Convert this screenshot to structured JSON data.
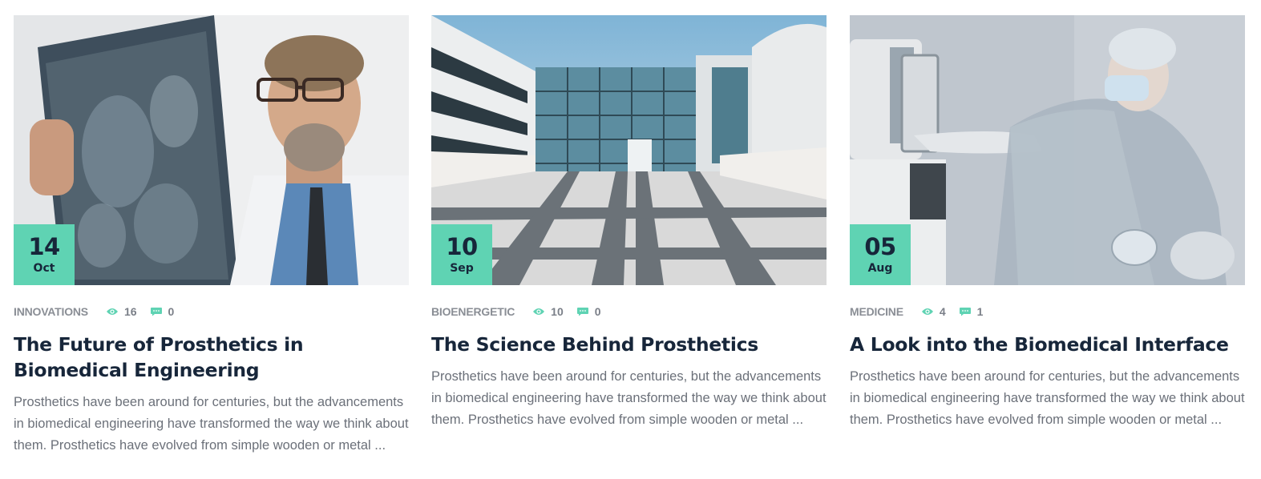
{
  "posts": [
    {
      "day": "14",
      "month": "Oct",
      "category": "INNOVATIONS",
      "views": "16",
      "comments": "0",
      "title": "The Future of Prosthetics in Biomedical Engineering",
      "excerpt": "Prosthetics have been around for centuries, but the advancements in biomedical engineering have transformed the way we think about them. Prosthetics have evolved from simple wooden or metal ..."
    },
    {
      "day": "10",
      "month": "Sep",
      "category": "BIOENERGETIC",
      "views": "10",
      "comments": "0",
      "title": "The Science Behind Prosthetics",
      "excerpt": "Prosthetics have been around for centuries, but the advancements in biomedical engineering have transformed the way we think about them. Prosthetics have evolved from simple wooden or metal ..."
    },
    {
      "day": "05",
      "month": "Aug",
      "category": "MEDICINE",
      "views": "4",
      "comments": "1",
      "title": "A Look into the Biomedical Interface",
      "excerpt": "Prosthetics have been around for centuries, but the advancements in biomedical engineering have transformed the way we think about them. Prosthetics have evolved from simple wooden or metal ..."
    }
  ],
  "colors": {
    "accent": "#5fd3b3",
    "heading": "#17263a",
    "text": "#6b7079",
    "meta": "#8a8e95"
  },
  "icons": {
    "views": "eye-icon",
    "comments": "comment-icon"
  }
}
